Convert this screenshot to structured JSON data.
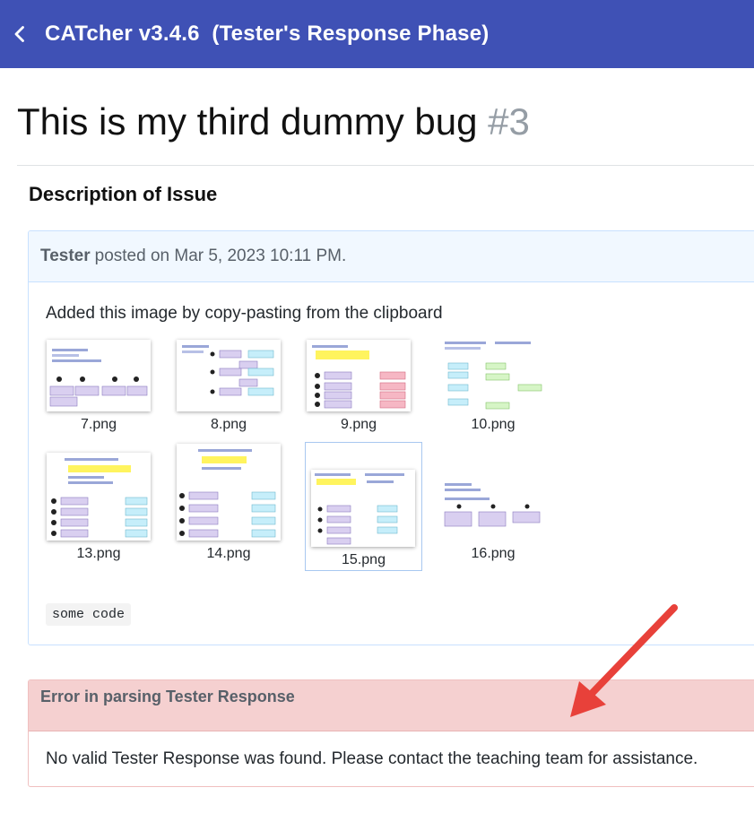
{
  "header": {
    "title": "CATcher v3.4.6  (Tester's Response Phase)",
    "background_color": "#3f51b5",
    "back_icon": "chevron-left-icon"
  },
  "issue": {
    "title": "This is my third dummy bug",
    "number": "#3"
  },
  "description": {
    "heading": "Description of Issue",
    "author": "Tester",
    "posted_text": "posted on Mar 5, 2023 10:11 PM.",
    "body_text": "Added this image by copy-pasting from the clipboard",
    "images": [
      {
        "caption": "7.png"
      },
      {
        "caption": "8.png"
      },
      {
        "caption": "9.png"
      },
      {
        "caption": "10.png"
      },
      {
        "caption": "13.png"
      },
      {
        "caption": "14.png"
      },
      {
        "caption": "15.png"
      },
      {
        "caption": "16.png"
      }
    ],
    "code_snippet": "some code"
  },
  "error": {
    "heading": "Error in parsing Tester Response",
    "message": "No valid Tester Response was found. Please contact the teaching team for assistance.",
    "header_color": "#f5d0d0"
  },
  "annotation": {
    "arrow_color": "#e8413a"
  }
}
